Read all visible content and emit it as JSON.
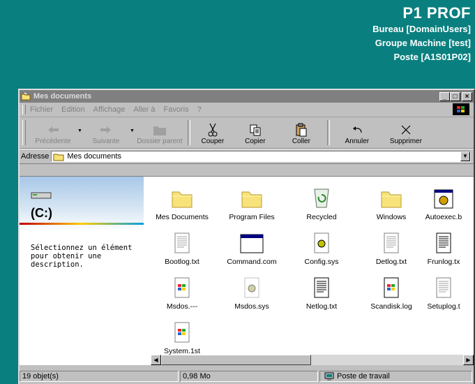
{
  "desktop": {
    "title": "P1 PROF",
    "lines": [
      "Bureau [DomainUsers]",
      "Groupe Machine [test]",
      "Poste [A1S01P02]"
    ]
  },
  "window": {
    "title": "Mes documents",
    "controls": {
      "minimize": "_",
      "maximize": "□",
      "close": "×"
    }
  },
  "menu": [
    {
      "label": "Fichier"
    },
    {
      "label": "Edition"
    },
    {
      "label": "Affichage"
    },
    {
      "label": "Aller à"
    },
    {
      "label": "Favoris"
    },
    {
      "label": "?"
    }
  ],
  "toolbar": {
    "back": "Précédente",
    "forward": "Suivante",
    "up": "Dossier parent",
    "cut": "Couper",
    "copy": "Copier",
    "paste": "Coller",
    "undo": "Annuler",
    "delete": "Supprimer"
  },
  "address": {
    "label": "Adresse",
    "value": "Mes documents"
  },
  "left_pane": {
    "drive": "(C:)",
    "description": "Sélectionnez un élément pour obtenir une description."
  },
  "items": [
    {
      "label": "Mes Documents",
      "icon": "folder-icon"
    },
    {
      "label": "Program Files",
      "icon": "folder-icon"
    },
    {
      "label": "Recycled",
      "icon": "recycle-bin-icon"
    },
    {
      "label": "Windows",
      "icon": "folder-icon"
    },
    {
      "label": "Autoexec.b",
      "icon": "batch-file-icon"
    },
    {
      "label": "Bootlog.txt",
      "icon": "text-file-icon"
    },
    {
      "label": "Command.com",
      "icon": "program-icon"
    },
    {
      "label": "Config.sys",
      "icon": "system-file-icon"
    },
    {
      "label": "Detlog.txt",
      "icon": "text-file-icon"
    },
    {
      "label": "Frunlog.tx",
      "icon": "text-file-icon"
    },
    {
      "label": "Msdos.---",
      "icon": "msdos-file-icon"
    },
    {
      "label": "Msdos.sys",
      "icon": "system-file-icon"
    },
    {
      "label": "Netlog.txt",
      "icon": "text-file-icon"
    },
    {
      "label": "Scandisk.log",
      "icon": "log-file-icon"
    },
    {
      "label": "Setuplog.t",
      "icon": "text-file-icon"
    },
    {
      "label": "System.1st",
      "icon": "msdos-file-icon"
    }
  ],
  "status": {
    "objects": "19 objet(s)",
    "size": "0,98 Mo",
    "zone": "Poste de travail"
  }
}
